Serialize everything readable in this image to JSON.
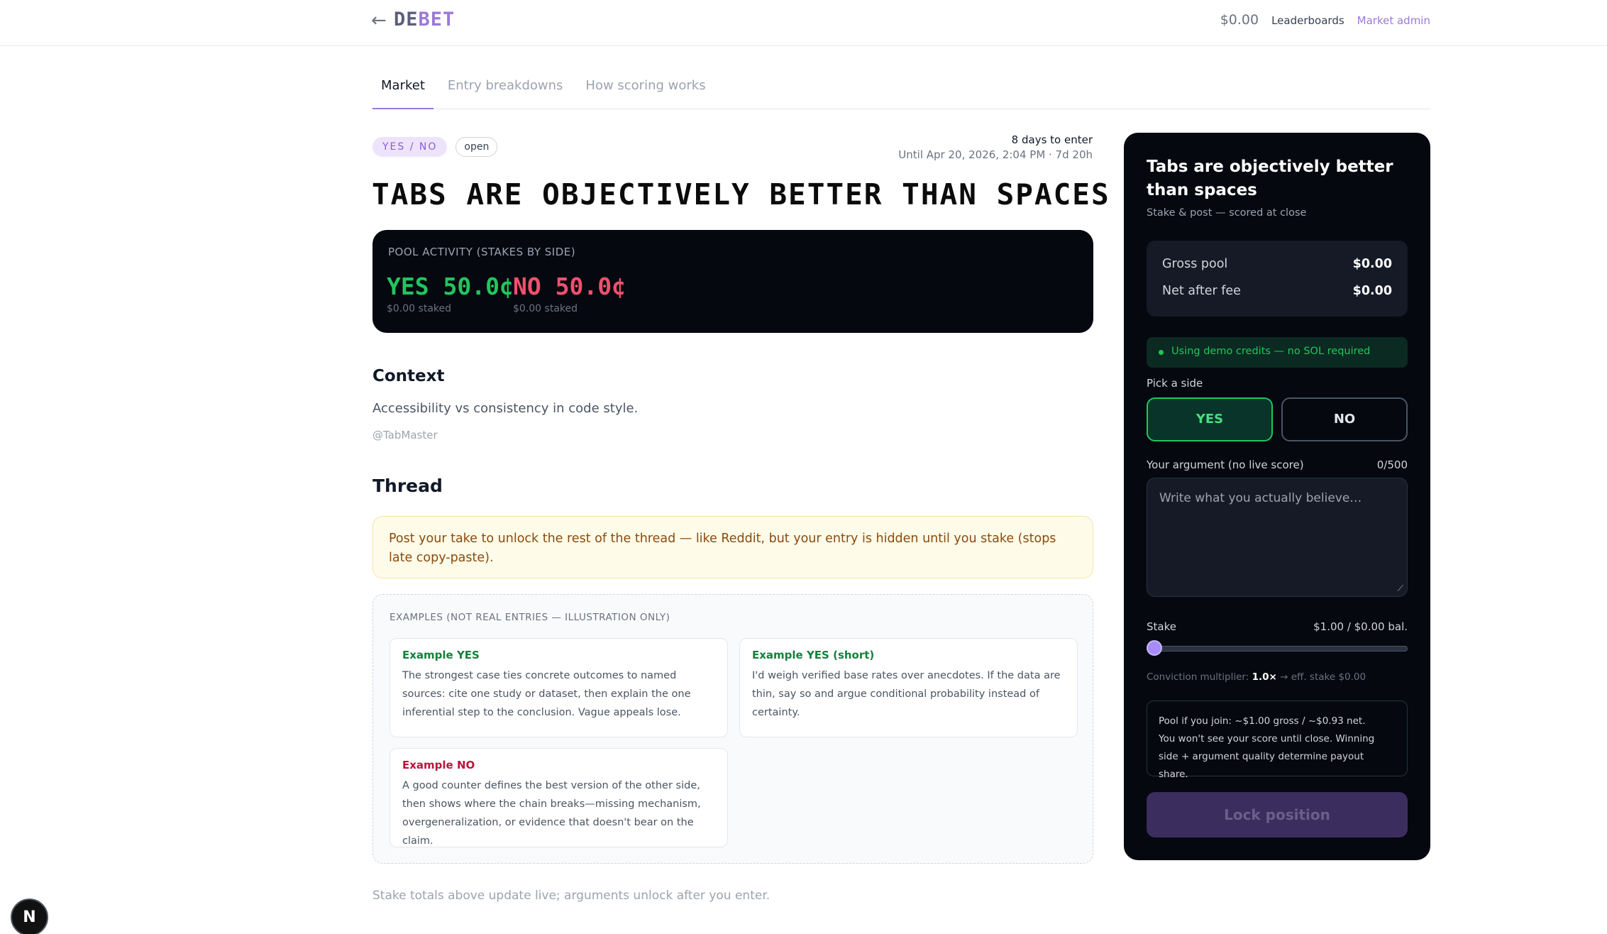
{
  "header": {
    "logo_part1": "DE",
    "logo_part2": "BET",
    "balance": "$0.00",
    "leaderboards": "Leaderboards",
    "market_admin": "Market admin"
  },
  "tabs": [
    {
      "label": "Market"
    },
    {
      "label": "Entry breakdowns"
    },
    {
      "label": "How scoring works"
    }
  ],
  "market": {
    "type_badge": "YES / NO",
    "status_badge": "open",
    "days_to_enter": "8 days to enter",
    "until": "Until Apr 20, 2026, 2:04 PM · 7d 20h",
    "title": "Tabs are objectively better than spaces"
  },
  "pool": {
    "label": "POOL ACTIVITY (STAKES BY SIDE)",
    "yes_value": "YES 50.0¢",
    "yes_staked": "$0.00 staked",
    "no_value": "NO 50.0¢",
    "no_staked": "$0.00 staked"
  },
  "context": {
    "heading": "Context",
    "text": "Accessibility vs consistency in code style.",
    "author": "@TabMaster"
  },
  "thread": {
    "heading": "Thread",
    "notice": "Post your take to unlock the rest of the thread — like Reddit, but your entry is hidden until you stake (stops late copy-paste).",
    "examples_heading": "EXAMPLES (NOT REAL ENTRIES — ILLUSTRATION ONLY)",
    "examples": [
      {
        "title": "Example YES",
        "body": "The strongest case ties concrete outcomes to named sources: cite one study or dataset, then explain the one inferential step to the conclusion. Vague appeals lose."
      },
      {
        "title": "Example YES (short)",
        "body": "I'd weigh verified base rates over anecdotes. If the data are thin, say so and argue conditional probability instead of certainty."
      },
      {
        "title": "Example NO",
        "body": "A good counter defines the best version of the other side, then shows where the chain breaks—missing mechanism, overgeneralization, or evidence that doesn't bear on the claim."
      }
    ]
  },
  "footnote": "Stake totals above update live; arguments unlock after you enter.",
  "panel": {
    "title": "Tabs are objectively better than spaces",
    "subtitle": "Stake & post — scored at close",
    "gross_pool_label": "Gross pool",
    "gross_pool_value": "$0.00",
    "net_label": "Net after fee",
    "net_value": "$0.00",
    "demo_notice": "Using demo credits — no SOL required",
    "pick_side": "Pick a side",
    "yes_button": "YES",
    "no_button": "NO",
    "argument_label": "Your argument (no live score)",
    "argument_count": "0/500",
    "argument_placeholder": "Write what you actually believe…",
    "stake_label": "Stake",
    "stake_value": "$1.00 / $0.00 bal.",
    "stake_slider_level": 0,
    "multiplier_prefix": "Conviction multiplier: ",
    "multiplier_value": "1.0×",
    "multiplier_suffix": " → eff. stake $0.00",
    "info_line1": "Pool if you join: ~$1.00 gross / ~$0.93 net.",
    "info_line2": "You won't see your score until close. Winning side + argument quality determine payout share.",
    "lock_button": "Lock position"
  },
  "dev_badge": "N",
  "colors": {
    "accent": "#9b7ad8",
    "yes": "#22c55e",
    "no": "#f0506e",
    "panel_bg": "#05080f"
  }
}
